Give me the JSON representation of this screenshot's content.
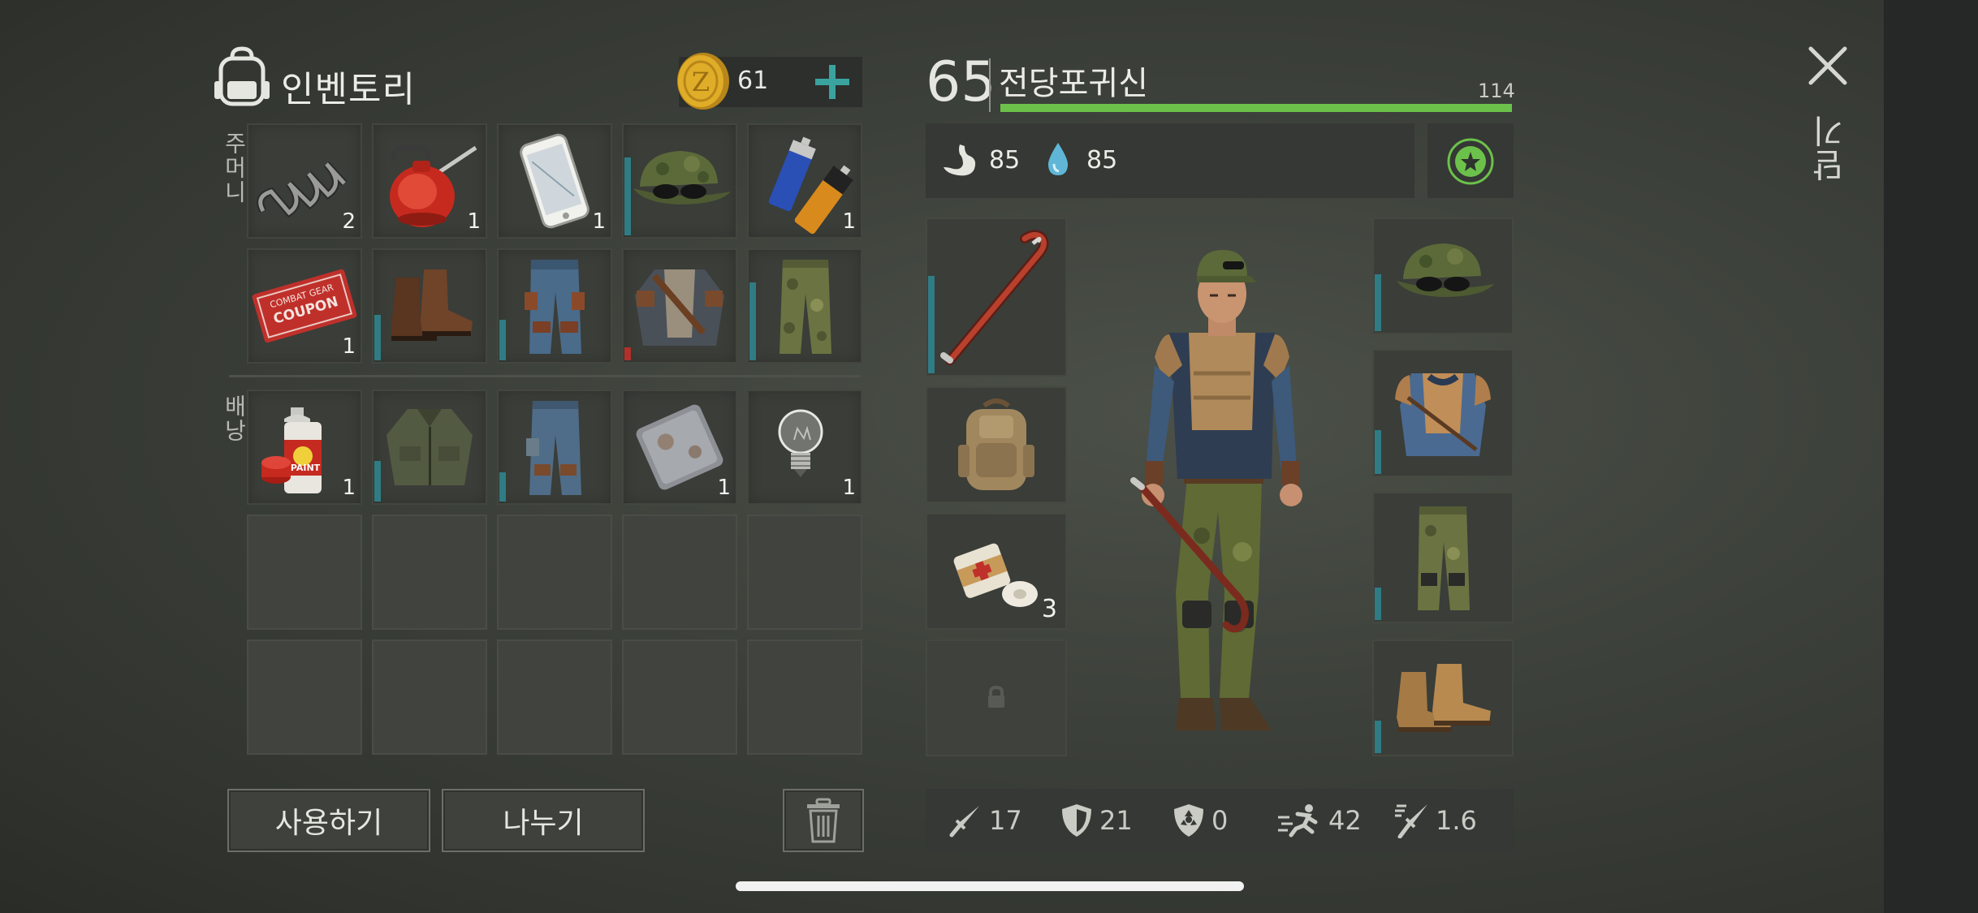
{
  "inventory": {
    "title": "인벤토리",
    "coins": "61",
    "pocket_label": "주머니",
    "backpack_label": "배낭",
    "pocket_items": [
      {
        "name": "spring",
        "count": "2"
      },
      {
        "name": "oil-can",
        "count": "1"
      },
      {
        "name": "smartphone",
        "count": "1"
      },
      {
        "name": "camo-cap-sunglasses",
        "count": "",
        "durability": 0.7
      },
      {
        "name": "batteries",
        "count": "1"
      },
      {
        "name": "combat-gear-coupon",
        "count": "1",
        "art_text": [
          "COMBAT GEAR",
          "COUPON"
        ]
      },
      {
        "name": "leather-boots",
        "count": "",
        "durability": 0.4
      },
      {
        "name": "cargo-pants-blue",
        "count": "",
        "durability": 0.35
      },
      {
        "name": "armored-jacket",
        "count": "",
        "durability": 0.12,
        "durability_color": "red"
      },
      {
        "name": "camo-pants",
        "count": "",
        "durability": 0.7
      }
    ],
    "backpack_items": [
      {
        "name": "spray-paint",
        "count": "1",
        "art_text": "PAINT"
      },
      {
        "name": "green-jacket",
        "count": "",
        "durability": 0.35
      },
      {
        "name": "blue-pants",
        "count": "",
        "durability": 0.25
      },
      {
        "name": "metal-plate",
        "count": "1"
      },
      {
        "name": "light-bulb",
        "count": "1"
      }
    ],
    "use_button": "사용하기",
    "split_button": "나누기"
  },
  "character": {
    "level": "65",
    "name": "전당포귀신",
    "hp": "114",
    "hunger": "85",
    "thirst": "85",
    "weapon_slot_count": "",
    "medkit_count": "3",
    "stats": {
      "damage": "17",
      "armor": "21",
      "protection": "0",
      "speed": "42",
      "attack_speed": "1.6"
    }
  },
  "close_label": "닫기",
  "colors": {
    "accent_teal": "#2f7c84",
    "hp_green": "#6cc14b",
    "coin_gold": "#d9a521",
    "plus_teal": "#3aa39f"
  }
}
